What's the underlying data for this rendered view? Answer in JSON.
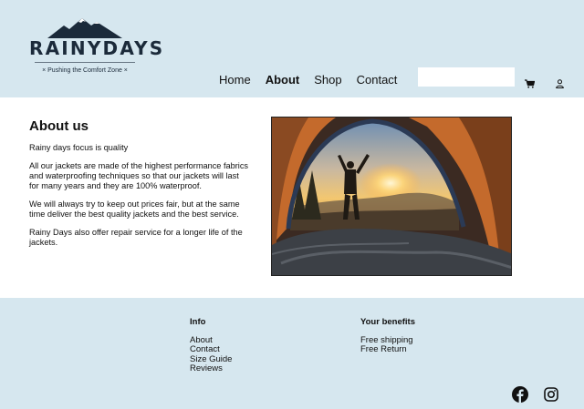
{
  "header": {
    "brand": "RAINYDAYS",
    "tagline": "× Pushing the Comfort Zone ×",
    "nav": [
      {
        "label": "Home",
        "active": false
      },
      {
        "label": "About",
        "active": true
      },
      {
        "label": "Shop",
        "active": false
      },
      {
        "label": "Contact",
        "active": false
      }
    ],
    "search": {
      "placeholder": "",
      "value": ""
    },
    "icons": [
      "cart-icon",
      "user-icon"
    ]
  },
  "main": {
    "heading": "About us",
    "paragraphs": [
      "Rainy days focus is quality",
      "All our jackets are made of the highest performance fabrics and waterproofing techniques so that our jackets will last for many years and they are 100% waterproof.",
      "We will always try to keep out prices fair, but at the same time deliver the best quality jackets and the best service.",
      "Rainy Days also offer repair service for a longer life of the jackets."
    ],
    "image": "tent-sunrise-photo"
  },
  "footer": {
    "info": {
      "title": "Info",
      "links": [
        "About",
        "Contact",
        "Size Guide",
        "Reviews"
      ]
    },
    "benefits": {
      "title": "Your benefits",
      "items": [
        "Free shipping",
        "Free Return"
      ]
    },
    "social": [
      "facebook-icon",
      "instagram-icon"
    ]
  },
  "colors": {
    "header_bg": "#d6e7ef",
    "footer_bg": "#d6e7ef",
    "text": "#111111",
    "logo": "#1b2a3a"
  }
}
